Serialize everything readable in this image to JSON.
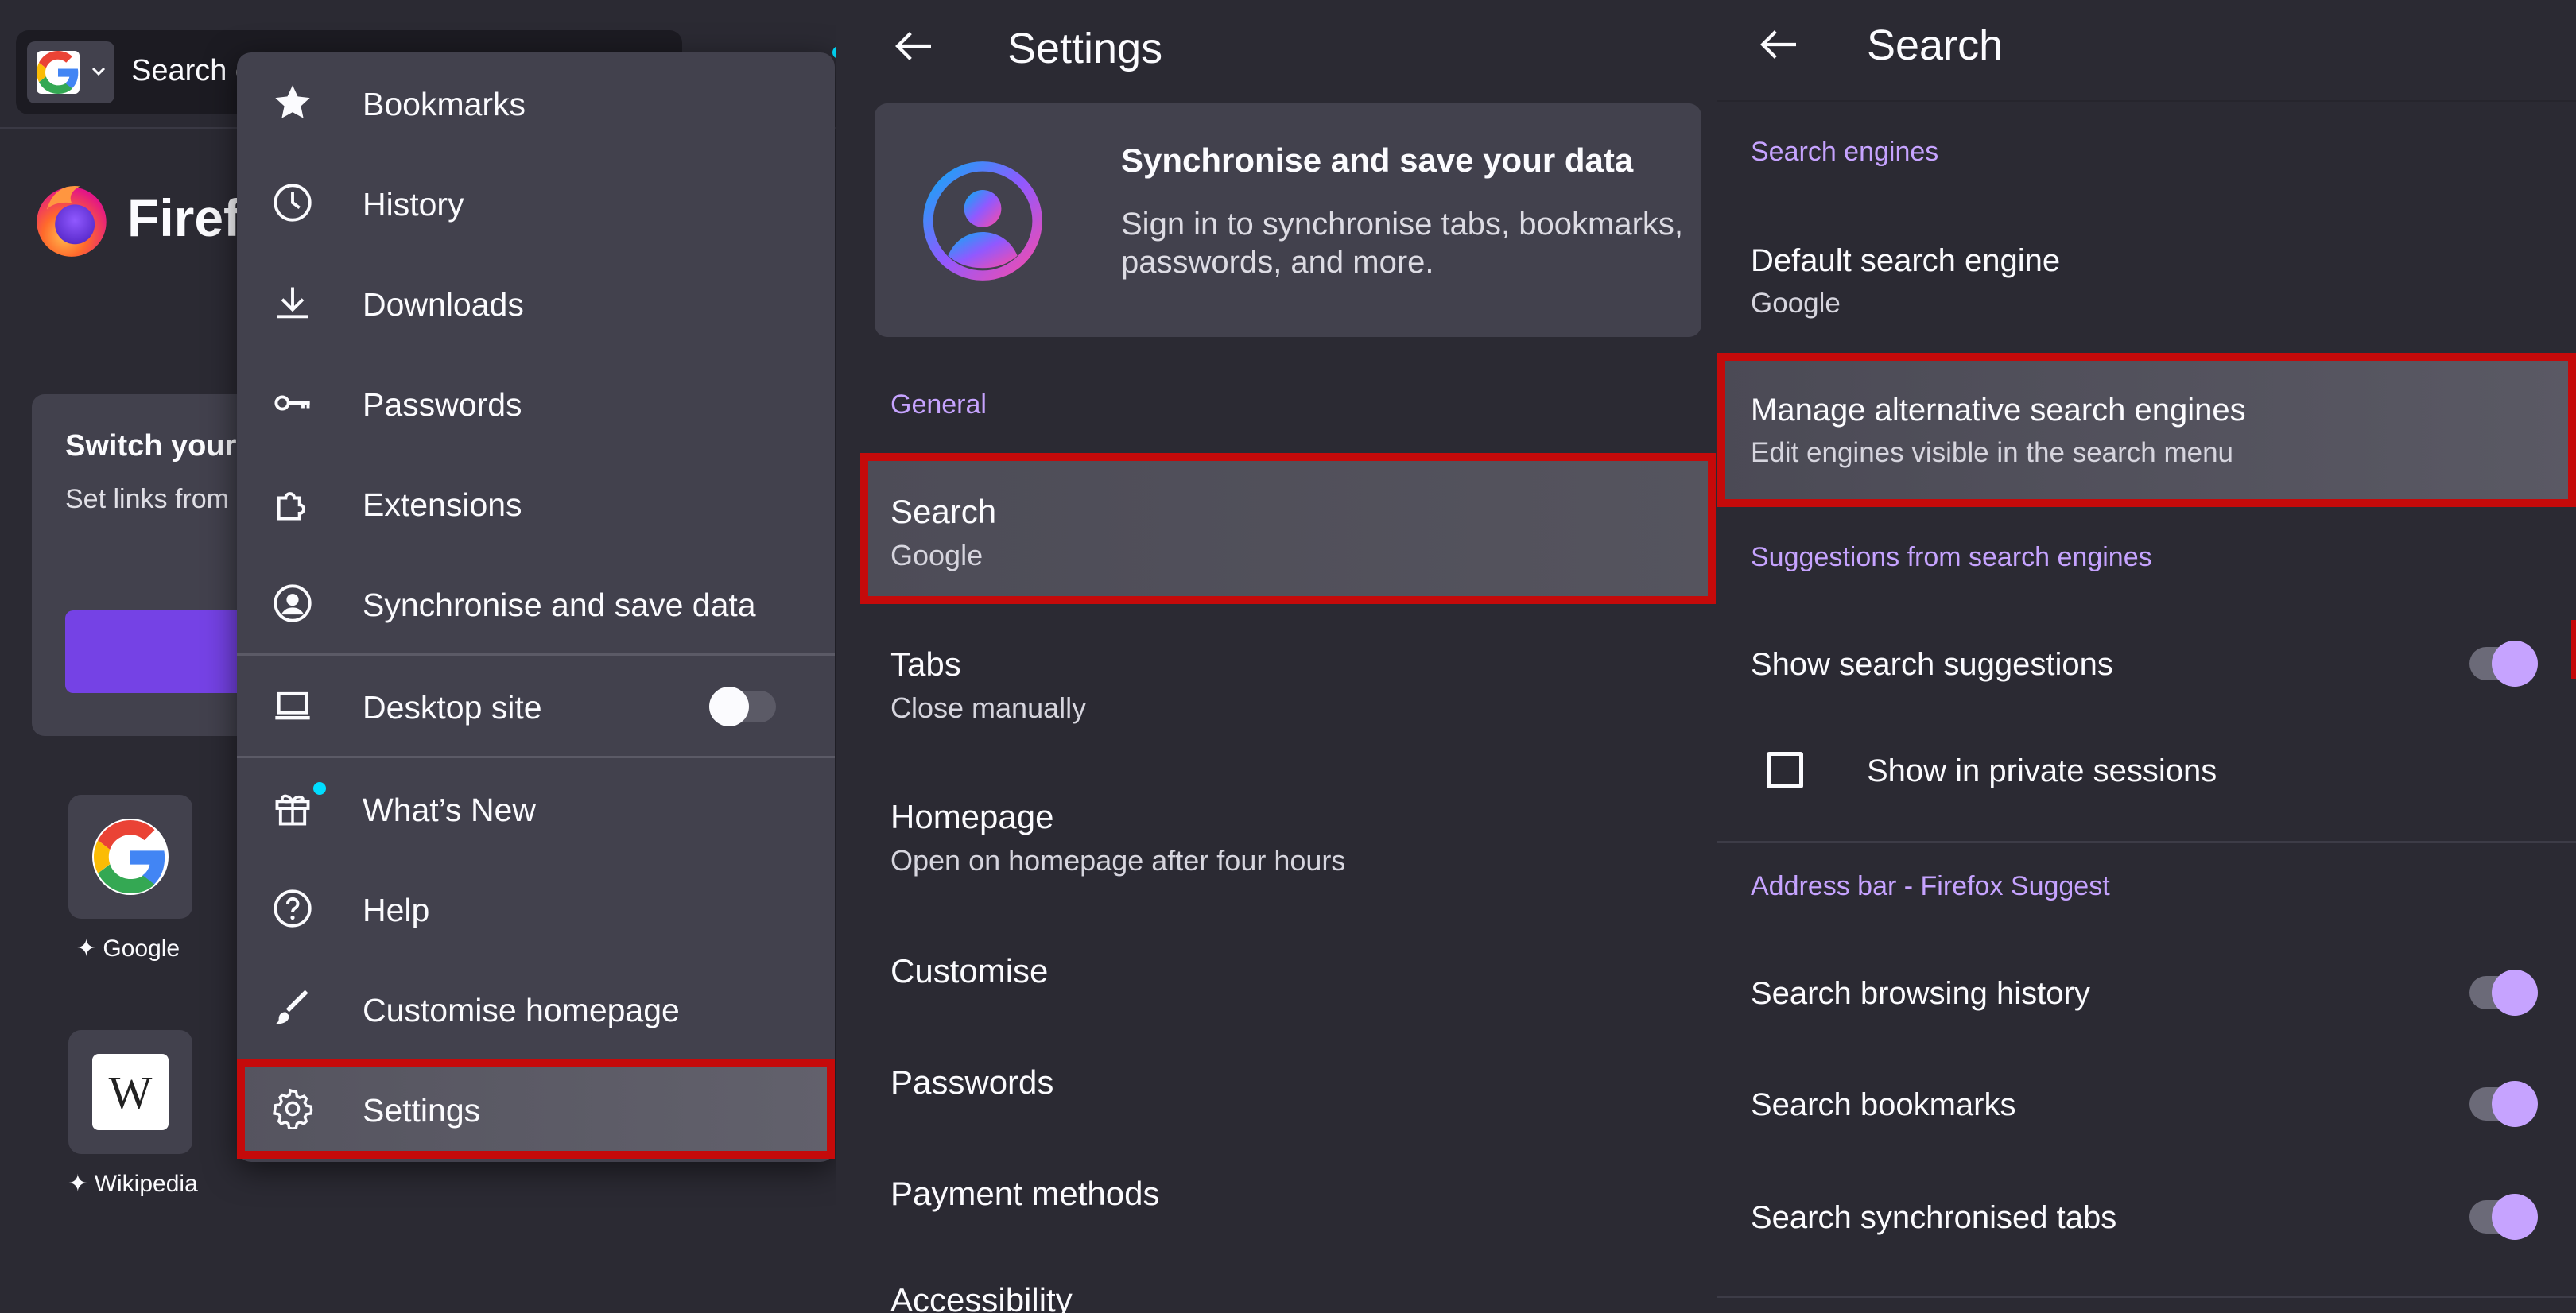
{
  "panel1": {
    "url_text": "Search o",
    "wordmark": "Firefo",
    "card": {
      "title": "Switch your",
      "body": "Set links from open automa"
    },
    "shortcuts": [
      {
        "label": "Google",
        "icon": "google-icon"
      },
      {
        "label": "Wikipedia",
        "icon": "wikipedia-icon",
        "letter": "W"
      }
    ],
    "menu": {
      "items": [
        {
          "label": "Bookmarks",
          "icon": "star-icon"
        },
        {
          "label": "History",
          "icon": "clock-icon"
        },
        {
          "label": "Downloads",
          "icon": "download-icon"
        },
        {
          "label": "Passwords",
          "icon": "key-icon"
        },
        {
          "label": "Extensions",
          "icon": "puzzle-icon"
        },
        {
          "label": "Synchronise and save data",
          "icon": "account-icon"
        },
        {
          "label": "Desktop site",
          "icon": "laptop-icon",
          "toggle": false
        },
        {
          "label": "What’s New",
          "icon": "gift-icon"
        },
        {
          "label": "Help",
          "icon": "help-icon"
        },
        {
          "label": "Customise homepage",
          "icon": "brush-icon"
        },
        {
          "label": "Settings",
          "icon": "gear-icon",
          "selected": true
        }
      ]
    }
  },
  "panel2": {
    "title": "Settings",
    "account": {
      "title": "Synchronise and save your data",
      "subtitle": "Sign in to synchronise tabs, bookmarks, passwords, and more."
    },
    "section_general": "General",
    "items": [
      {
        "title": "Search",
        "subtitle": "Google",
        "selected": true
      },
      {
        "title": "Tabs",
        "subtitle": "Close manually"
      },
      {
        "title": "Homepage",
        "subtitle": "Open on homepage after four hours"
      },
      {
        "title": "Customise"
      },
      {
        "title": "Passwords"
      },
      {
        "title": "Payment methods"
      },
      {
        "title": "Accessibility"
      }
    ]
  },
  "panel3": {
    "title": "Search",
    "section_engines": "Search engines",
    "default_engine": {
      "title": "Default search engine",
      "subtitle": "Google"
    },
    "manage_engines": {
      "title": "Manage alternative search engines",
      "subtitle": "Edit engines visible in the search menu",
      "selected": true
    },
    "section_suggestions": "Suggestions from search engines",
    "show_suggestions": {
      "title": "Show search suggestions",
      "on": true
    },
    "show_private": {
      "title": "Show in private sessions",
      "checked": false
    },
    "section_address_bar": "Address bar - Firefox Suggest",
    "browsing_history": {
      "title": "Search browsing history",
      "on": true
    },
    "bookmarks": {
      "title": "Search bookmarks",
      "on": true
    },
    "synced_tabs": {
      "title": "Search synchronised tabs",
      "on": true
    }
  },
  "colors": {
    "background": "#2b2a33",
    "surface": "#42414d",
    "accent_purple": "#c6a3ff",
    "highlight_red": "#c50a0a",
    "primary_button": "#7542e5"
  }
}
